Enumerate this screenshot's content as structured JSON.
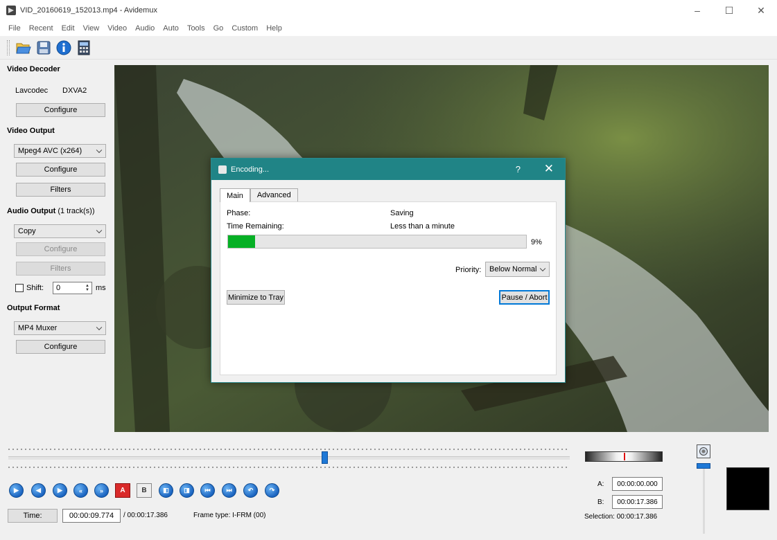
{
  "window": {
    "title": "VID_20160619_152013.mp4 - Avidemux",
    "controls": [
      "–",
      "☐",
      "✕"
    ]
  },
  "menu": [
    "File",
    "Recent",
    "Edit",
    "View",
    "Video",
    "Audio",
    "Auto",
    "Tools",
    "Go",
    "Custom",
    "Help"
  ],
  "toolbar": [
    "open-icon",
    "save-icon",
    "info-icon",
    "calculator-icon"
  ],
  "left": {
    "video_decoder": {
      "title": "Video Decoder",
      "codec_label": "Lavcodec",
      "codec_value": "DXVA2",
      "configure": "Configure"
    },
    "video_output": {
      "title": "Video Output",
      "selected": "Mpeg4 AVC (x264)",
      "configure": "Configure",
      "filters": "Filters"
    },
    "audio_output": {
      "title": "Audio Output",
      "tracks": "(1 track(s))",
      "selected": "Copy",
      "configure": "Configure",
      "filters": "Filters",
      "shift_label": "Shift:",
      "shift_value": "0",
      "shift_unit": "ms"
    },
    "output_format": {
      "title": "Output Format",
      "selected": "MP4 Muxer",
      "configure": "Configure"
    }
  },
  "dialog": {
    "title": "Encoding...",
    "help": "?",
    "close": "✕",
    "tabs": [
      "Main",
      "Advanced"
    ],
    "phase_label": "Phase:",
    "phase_value": "Saving",
    "time_label": "Time Remaining:",
    "time_value": "Less than a minute",
    "progress_percent": 9,
    "progress_text": "9%",
    "priority_label": "Priority:",
    "priority_value": "Below Normal",
    "minimize_button": "Minimize to Tray",
    "pause_button": "Pause / Abort"
  },
  "bottom": {
    "slider_position": 0.5625,
    "time_button": "Time:",
    "current_time": "00:00:09.774",
    "total_time": "/ 00:00:17.386",
    "frame_type": "Frame type:  I-FRM (00)",
    "a_label": "A:",
    "a_value": "00:00:00.000",
    "b_label": "B:",
    "b_value": "00:00:17.386",
    "selection": "Selection: 00:00:17.386",
    "nav_buttons": [
      "play-icon",
      "previous-frame-icon",
      "next-frame-icon",
      "previous-keyframe-icon",
      "next-keyframe-icon",
      "set-marker-a-icon",
      "set-marker-b-icon",
      "previous-black-frame-icon",
      "next-black-frame-icon",
      "go-to-first-frame-icon",
      "go-to-last-frame-icon",
      "go-to-marker-a-icon",
      "go-to-marker-b-icon"
    ],
    "marker_a_text": "A",
    "marker_b_text": "B"
  }
}
